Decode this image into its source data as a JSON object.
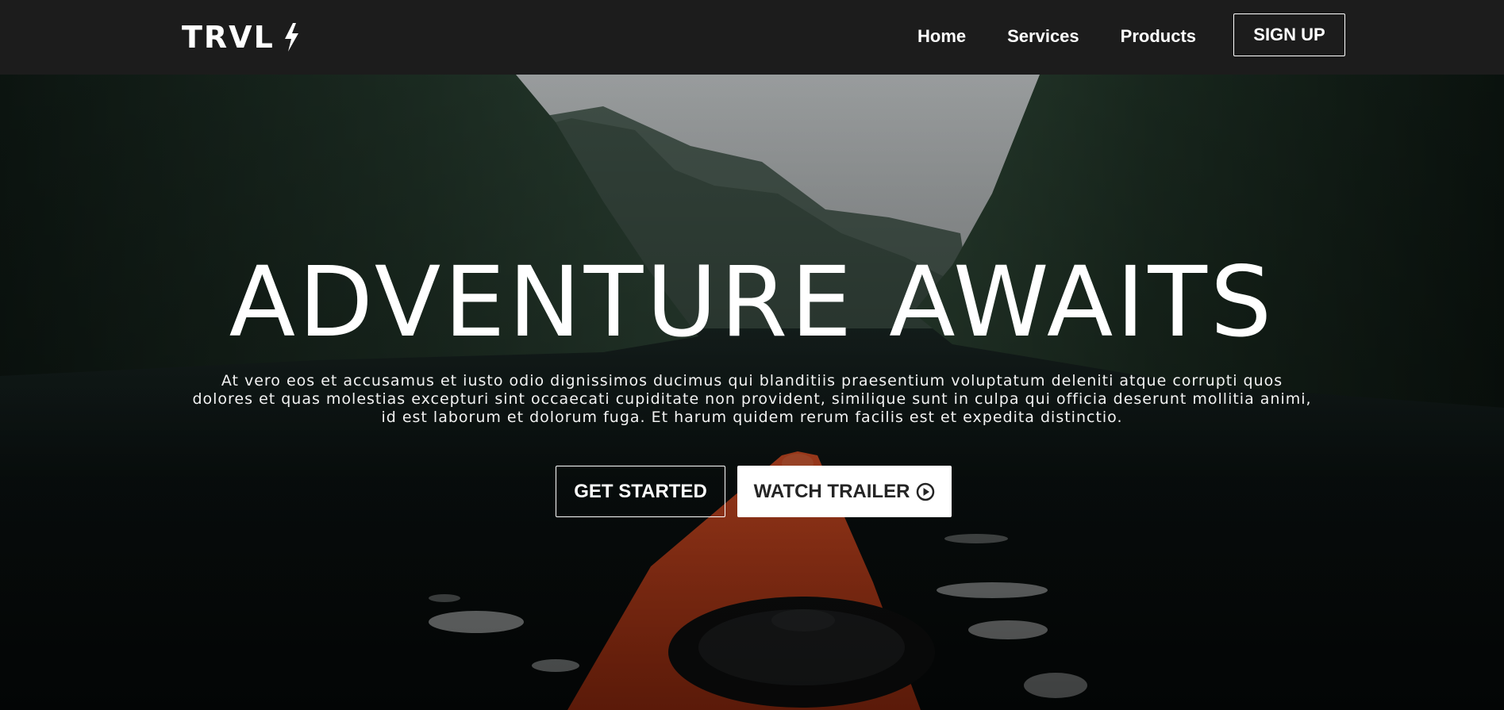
{
  "brand": {
    "name": "TRVL",
    "logo_icon": "lightning-bolt-icon"
  },
  "nav": {
    "links": [
      {
        "label": "Home"
      },
      {
        "label": "Services"
      },
      {
        "label": "Products"
      }
    ],
    "signup_label": "SIGN UP"
  },
  "hero": {
    "title": "ADVENTURE AWAITS",
    "subtitle": "At vero eos et accusamus et iusto odio dignissimos ducimus qui blanditiis praesentium voluptatum deleniti atque corrupti quos dolores et quas molestias excepturi sint occaecati cupiditate non provident, similique sunt in culpa qui officia deserunt mollitia animi, id est laborum et dolorum fuga. Et harum quidem rerum facilis est et expedita distinctio.",
    "buttons": {
      "get_started": "GET STARTED",
      "watch_trailer": "WATCH TRAILER",
      "trailer_icon": "play-circle-icon"
    },
    "background": "kayak-on-fjord-photo"
  },
  "colors": {
    "navbar_bg": "#1c1c1c",
    "text": "#ffffff",
    "kayak_accent": "#e2471e",
    "trailer_button_bg": "#ffffff",
    "trailer_button_text": "#242424"
  }
}
